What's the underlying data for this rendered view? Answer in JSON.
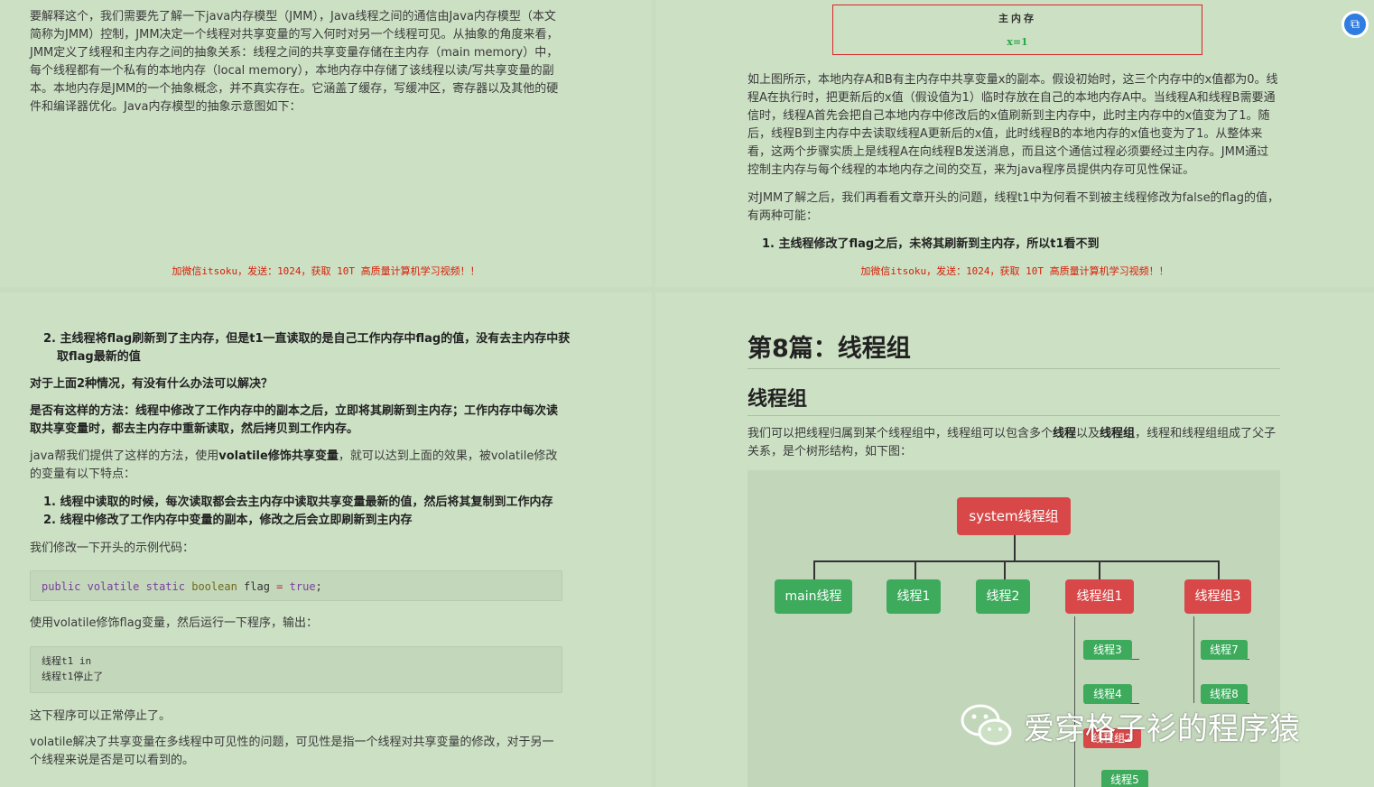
{
  "top_left": {
    "paragraph": "要解释这个，我们需要先了解一下java内存模型（JMM），Java线程之间的通信由Java内存模型（本文简称为JMM）控制，JMM决定一个线程对共享变量的写入何时对另一个线程可见。从抽象的角度来看，JMM定义了线程和主内存之间的抽象关系：线程之间的共享变量存储在主内存（main memory）中，每个线程都有一个私有的本地内存（local memory），本地内存中存储了该线程以读/写共享变量的副本。本地内存是JMM的一个抽象概念，并不真实存在。它涵盖了缓存，写缓冲区，寄存器以及其他的硬件和编译器优化。Java内存模型的抽象示意图如下：",
    "footer": "加微信itsoku，发送：1024，获取 10T 高质量计算机学习视频！！"
  },
  "top_right": {
    "memory_box_title": "主内存",
    "memory_box_value": "x=1",
    "paragraph1": "如上图所示，本地内存A和B有主内存中共享变量x的副本。假设初始时，这三个内存中的x值都为0。线程A在执行时，把更新后的x值（假设值为1）临时存放在自己的本地内存A中。当线程A和线程B需要通信时，线程A首先会把自己本地内存中修改后的x值刷新到主内存中，此时主内存中的x值变为了1。随后，线程B到主内存中去读取线程A更新后的x值，此时线程B的本地内存的x值也变为了1。从整体来看，这两个步骤实质上是线程A在向线程B发送消息，而且这个通信过程必须要经过主内存。JMM通过控制主内存与每个线程的本地内存之间的交互，来为java程序员提供内存可见性保证。",
    "paragraph2": "对JMM了解之后，我们再看看文章开头的问题，线程t1中为何看不到被主线程修改为false的flag的值，有两种可能：",
    "list_item1": "1. 主线程修改了flag之后，未将其刷新到主内存，所以t1看不到",
    "footer": "加微信itsoku，发送：1024，获取 10T 高质量计算机学习视频！！"
  },
  "bottom_left": {
    "list_item2_line1": "2. 主线程将flag刷新到了主内存，但是t1一直读取的是自己工作内存中flag的值，没有去主内存中获",
    "list_item2_line2": "取flag最新的值",
    "question": "对于上面2种情况，有没有什么办法可以解决？",
    "answer": "是否有这样的方法：线程中修改了工作内存中的副本之后，立即将其刷新到主内存；工作内存中每次读取共享变量时，都去主内存中重新读取，然后拷贝到工作内存。",
    "java_para_pre": "java帮我们提供了这样的方法，使用",
    "java_para_bold": "volatile修饰共享变量",
    "java_para_post": "，就可以达到上面的效果，被volatile修改的变量有以下特点：",
    "feature1": "1. 线程中读取的时候，每次读取都会去主内存中读取共享变量最新的值，然后将其复制到工作内存",
    "feature2": "2. 线程中修改了工作内存中变量的副本，修改之后会立即刷新到主内存",
    "modify_intro": "我们修改一下开头的示例代码：",
    "code_public": "public",
    "code_volatile": "volatile",
    "code_static": "static",
    "code_boolean": "boolean",
    "code_flag": "flag",
    "code_eq": "=",
    "code_true": "true",
    "code_semi": ";",
    "run_intro": "使用volatile修饰flag变量，然后运行一下程序，输出：",
    "output_line1": "线程t1 in",
    "output_line2": "线程t1停止了",
    "stopped": "这下程序可以正常停止了。",
    "summary": "volatile解决了共享变量在多线程中可见性的问题，可见性是指一个线程对共享变量的修改，对于另一个线程来说是否是可以看到的。"
  },
  "bottom_right": {
    "h1": "第8篇：线程组",
    "h2": "线程组",
    "para_pre": "我们可以把线程归属到某个线程组中，线程组可以包含多个",
    "para_b1": "线程",
    "para_mid": "以及",
    "para_b2": "线程组",
    "para_post": "，线程和线程组组成了父子关系，是个树形结构，如下图：",
    "tree": {
      "root": "system线程组",
      "main": "main线程",
      "t1": "线程1",
      "t2": "线程2",
      "g1": "线程组1",
      "g3": "线程组3",
      "t3": "线程3",
      "t4": "线程4",
      "g2": "线程组2",
      "t5": "线程5",
      "t7": "线程7",
      "t8": "线程8"
    }
  },
  "watermark": "爱穿格子衫的程序猿",
  "colors": {
    "page_bg": "#cce0c4",
    "node_red": "#d84848",
    "node_green": "#3daa5c",
    "footer_red": "#d81e06"
  }
}
